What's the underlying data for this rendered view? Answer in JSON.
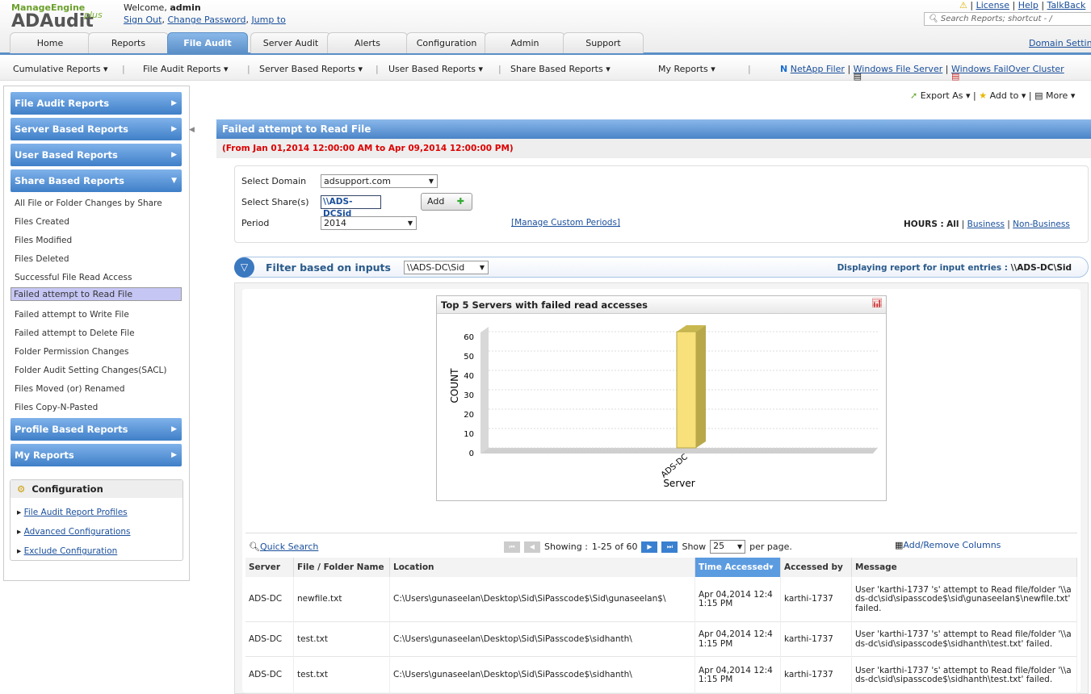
{
  "header": {
    "brand_top": "ManageEngine",
    "brand": "ADAudit",
    "brand_suffix": "plus",
    "welcome": "Welcome,",
    "user": "admin",
    "links": [
      "Sign Out",
      "Change Password",
      "Jump to"
    ],
    "top_links": [
      "License",
      "Help",
      "TalkBack"
    ],
    "search_placeholder": "Search Reports; shortcut - /",
    "domain_settings": "Domain Settings"
  },
  "tabs": [
    {
      "label": "Home"
    },
    {
      "label": "Reports"
    },
    {
      "label": "File Audit",
      "active": true
    },
    {
      "label": "Server Audit"
    },
    {
      "label": "Alerts"
    },
    {
      "label": "Configuration"
    },
    {
      "label": "Admin"
    },
    {
      "label": "Support"
    }
  ],
  "submenu": [
    "Cumulative Reports ▾",
    "File Audit Reports ▾",
    "Server Based Reports ▾",
    "User Based Reports ▾",
    "Share Based Reports ▾",
    "My Reports ▾"
  ],
  "server_links": [
    "NetApp Filer",
    "Windows File Server",
    "Windows FailOver Cluster"
  ],
  "actions": [
    "Export As ▾",
    "Add to ▾",
    "More ▾"
  ],
  "sidebar": {
    "sections_top": [
      "File Audit Reports",
      "Server Based Reports",
      "User Based Reports",
      "Share Based Reports"
    ],
    "items": [
      "All File or Folder Changes by Share",
      "Files Created",
      "Files Modified",
      "Files Deleted",
      "Successful File Read Access",
      "Failed attempt to Read File",
      "Failed attempt to Write File",
      "Failed attempt to Delete File",
      "Folder Permission Changes",
      "Folder Audit Setting Changes(SACL)",
      "Files Moved (or) Renamed",
      "Files Copy-N-Pasted"
    ],
    "selected": 5,
    "sections_bottom": [
      "Profile Based Reports",
      "My Reports"
    ],
    "config_title": "Configuration",
    "config_links": [
      "File Audit Report Profiles",
      "Advanced Configurations",
      "Exclude Configuration"
    ]
  },
  "report": {
    "title": "Failed attempt to Read File",
    "range": "(From Jan 01,2014 12:00:00 AM to Apr 09,2014 12:00:00 PM)",
    "domain_label": "Select Domain",
    "domain": "adsupport.com",
    "share_label": "Select Share(s)",
    "share": "\\\\ADS-DCSid",
    "add": "Add",
    "period_label": "Period",
    "period": "2014",
    "manage": "[Manage Custom Periods]",
    "hours_label": "HOURS :",
    "hours_all": "All",
    "business": "Business",
    "non_business": "Non-Business",
    "filter_label": "Filter based on inputs",
    "filter_value": "\\\\ADS-DC\\Sid",
    "displaying": "Displaying report for input entries :",
    "displaying_value": "\\\\ADS-DC\\Sid"
  },
  "chart_data": {
    "type": "bar",
    "title": "Top 5 Servers with failed read accesses",
    "categories": [
      "ADS-DC"
    ],
    "values": [
      60
    ],
    "xlabel": "Server",
    "ylabel": "COUNT",
    "ylim": [
      0,
      60
    ],
    "yticks": [
      0,
      10,
      20,
      30,
      40,
      50,
      60
    ],
    "grid": true,
    "bar_color": "#f8e07a"
  },
  "grid": {
    "quick_search": "Quick Search",
    "showing_label": "Showing :",
    "showing": "1-25 of 60",
    "show": "Show",
    "per_page_value": "25",
    "per_page": "per page.",
    "add_remove": "Add/Remove Columns",
    "columns": [
      "Server",
      "File / Folder Name",
      "Location",
      "Time Accessed▾",
      "Accessed by",
      "Message"
    ],
    "rows": [
      [
        "ADS-DC",
        "newfile.txt",
        "C:\\Users\\gunaseelan\\Desktop\\Sid\\SiPasscode$\\Sid\\gunaseelan$\\",
        "Apr 04,2014 12:41:15 PM",
        "karthi-1737",
        "User 'karthi-1737 's' attempt to Read file/folder '\\\\ads-dc\\sid\\sipasscode$\\sid\\gunaseelan$\\newfile.txt' failed."
      ],
      [
        "ADS-DC",
        "test.txt",
        "C:\\Users\\gunaseelan\\Desktop\\Sid\\SiPasscode$\\sidhanth\\",
        "Apr 04,2014 12:41:15 PM",
        "karthi-1737",
        "User 'karthi-1737 's' attempt to Read file/folder '\\\\ads-dc\\sid\\sipasscode$\\sidhanth\\test.txt' failed."
      ],
      [
        "ADS-DC",
        "test.txt",
        "C:\\Users\\gunaseelan\\Desktop\\Sid\\SiPasscode$\\sidhanth\\",
        "Apr 04,2014 12:41:15 PM",
        "karthi-1737",
        "User 'karthi-1737 's' attempt to Read file/folder '\\\\ads-dc\\sid\\sipasscode$\\sidhanth\\test.txt' failed."
      ]
    ]
  }
}
